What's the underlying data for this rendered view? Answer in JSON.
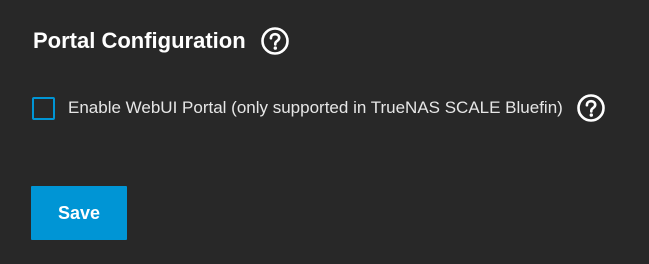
{
  "portal_config": {
    "title": "Portal Configuration",
    "title_help_icon": "help-circle-icon",
    "enable_webui": {
      "label": "Enable WebUI Portal (only supported in TrueNAS SCALE Bluefin)",
      "checked": false,
      "help_icon": "help-circle-icon"
    },
    "save_label": "Save"
  },
  "colors": {
    "background": "#282828",
    "accent": "#0095d5",
    "text": "#ffffff"
  }
}
